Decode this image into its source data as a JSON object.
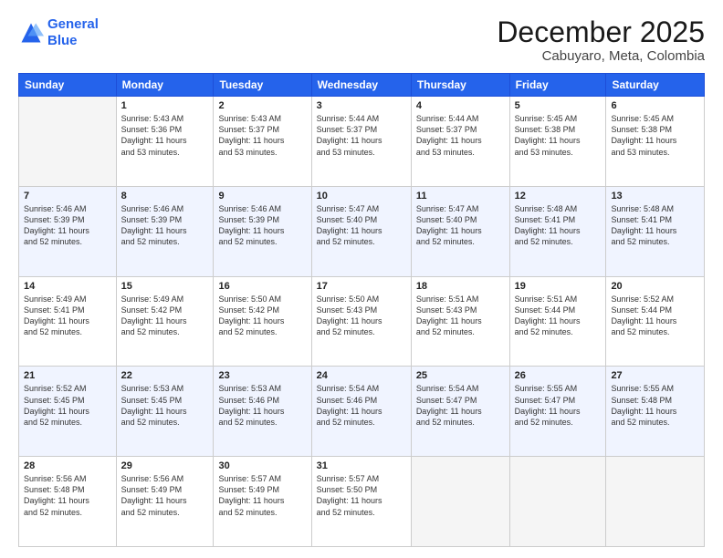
{
  "logo": {
    "line1": "General",
    "line2": "Blue"
  },
  "title": "December 2025",
  "subtitle": "Cabuyaro, Meta, Colombia",
  "weekdays": [
    "Sunday",
    "Monday",
    "Tuesday",
    "Wednesday",
    "Thursday",
    "Friday",
    "Saturday"
  ],
  "weeks": [
    [
      {
        "day": "",
        "info": ""
      },
      {
        "day": "1",
        "info": "Sunrise: 5:43 AM\nSunset: 5:36 PM\nDaylight: 11 hours\nand 53 minutes."
      },
      {
        "day": "2",
        "info": "Sunrise: 5:43 AM\nSunset: 5:37 PM\nDaylight: 11 hours\nand 53 minutes."
      },
      {
        "day": "3",
        "info": "Sunrise: 5:44 AM\nSunset: 5:37 PM\nDaylight: 11 hours\nand 53 minutes."
      },
      {
        "day": "4",
        "info": "Sunrise: 5:44 AM\nSunset: 5:37 PM\nDaylight: 11 hours\nand 53 minutes."
      },
      {
        "day": "5",
        "info": "Sunrise: 5:45 AM\nSunset: 5:38 PM\nDaylight: 11 hours\nand 53 minutes."
      },
      {
        "day": "6",
        "info": "Sunrise: 5:45 AM\nSunset: 5:38 PM\nDaylight: 11 hours\nand 53 minutes."
      }
    ],
    [
      {
        "day": "7",
        "info": "Sunrise: 5:46 AM\nSunset: 5:39 PM\nDaylight: 11 hours\nand 52 minutes."
      },
      {
        "day": "8",
        "info": "Sunrise: 5:46 AM\nSunset: 5:39 PM\nDaylight: 11 hours\nand 52 minutes."
      },
      {
        "day": "9",
        "info": "Sunrise: 5:46 AM\nSunset: 5:39 PM\nDaylight: 11 hours\nand 52 minutes."
      },
      {
        "day": "10",
        "info": "Sunrise: 5:47 AM\nSunset: 5:40 PM\nDaylight: 11 hours\nand 52 minutes."
      },
      {
        "day": "11",
        "info": "Sunrise: 5:47 AM\nSunset: 5:40 PM\nDaylight: 11 hours\nand 52 minutes."
      },
      {
        "day": "12",
        "info": "Sunrise: 5:48 AM\nSunset: 5:41 PM\nDaylight: 11 hours\nand 52 minutes."
      },
      {
        "day": "13",
        "info": "Sunrise: 5:48 AM\nSunset: 5:41 PM\nDaylight: 11 hours\nand 52 minutes."
      }
    ],
    [
      {
        "day": "14",
        "info": "Sunrise: 5:49 AM\nSunset: 5:41 PM\nDaylight: 11 hours\nand 52 minutes."
      },
      {
        "day": "15",
        "info": "Sunrise: 5:49 AM\nSunset: 5:42 PM\nDaylight: 11 hours\nand 52 minutes."
      },
      {
        "day": "16",
        "info": "Sunrise: 5:50 AM\nSunset: 5:42 PM\nDaylight: 11 hours\nand 52 minutes."
      },
      {
        "day": "17",
        "info": "Sunrise: 5:50 AM\nSunset: 5:43 PM\nDaylight: 11 hours\nand 52 minutes."
      },
      {
        "day": "18",
        "info": "Sunrise: 5:51 AM\nSunset: 5:43 PM\nDaylight: 11 hours\nand 52 minutes."
      },
      {
        "day": "19",
        "info": "Sunrise: 5:51 AM\nSunset: 5:44 PM\nDaylight: 11 hours\nand 52 minutes."
      },
      {
        "day": "20",
        "info": "Sunrise: 5:52 AM\nSunset: 5:44 PM\nDaylight: 11 hours\nand 52 minutes."
      }
    ],
    [
      {
        "day": "21",
        "info": "Sunrise: 5:52 AM\nSunset: 5:45 PM\nDaylight: 11 hours\nand 52 minutes."
      },
      {
        "day": "22",
        "info": "Sunrise: 5:53 AM\nSunset: 5:45 PM\nDaylight: 11 hours\nand 52 minutes."
      },
      {
        "day": "23",
        "info": "Sunrise: 5:53 AM\nSunset: 5:46 PM\nDaylight: 11 hours\nand 52 minutes."
      },
      {
        "day": "24",
        "info": "Sunrise: 5:54 AM\nSunset: 5:46 PM\nDaylight: 11 hours\nand 52 minutes."
      },
      {
        "day": "25",
        "info": "Sunrise: 5:54 AM\nSunset: 5:47 PM\nDaylight: 11 hours\nand 52 minutes."
      },
      {
        "day": "26",
        "info": "Sunrise: 5:55 AM\nSunset: 5:47 PM\nDaylight: 11 hours\nand 52 minutes."
      },
      {
        "day": "27",
        "info": "Sunrise: 5:55 AM\nSunset: 5:48 PM\nDaylight: 11 hours\nand 52 minutes."
      }
    ],
    [
      {
        "day": "28",
        "info": "Sunrise: 5:56 AM\nSunset: 5:48 PM\nDaylight: 11 hours\nand 52 minutes."
      },
      {
        "day": "29",
        "info": "Sunrise: 5:56 AM\nSunset: 5:49 PM\nDaylight: 11 hours\nand 52 minutes."
      },
      {
        "day": "30",
        "info": "Sunrise: 5:57 AM\nSunset: 5:49 PM\nDaylight: 11 hours\nand 52 minutes."
      },
      {
        "day": "31",
        "info": "Sunrise: 5:57 AM\nSunset: 5:50 PM\nDaylight: 11 hours\nand 52 minutes."
      },
      {
        "day": "",
        "info": ""
      },
      {
        "day": "",
        "info": ""
      },
      {
        "day": "",
        "info": ""
      }
    ]
  ]
}
